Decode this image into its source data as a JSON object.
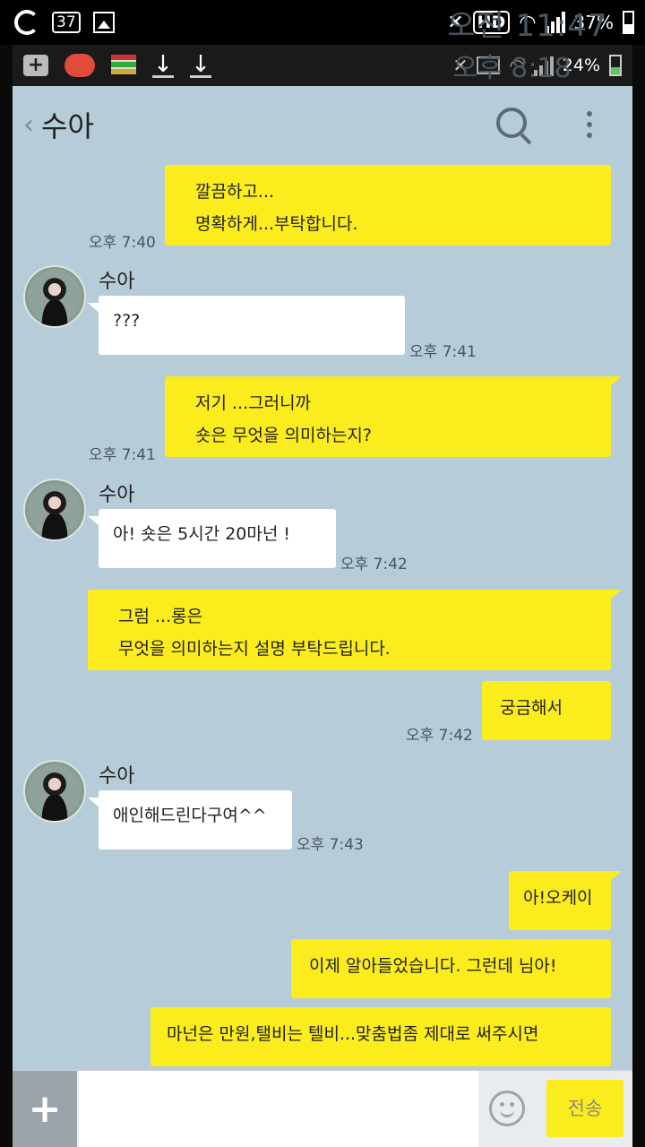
{
  "status_outer": {
    "badge": "37",
    "hd": "HD",
    "battery": "37%",
    "time": "오전 11:47"
  },
  "status_inner": {
    "battery": "24%",
    "time": "오후 8:18"
  },
  "header": {
    "title": "수아"
  },
  "messages": [
    {
      "side": "me",
      "lines": [
        "깔끔하고...",
        "명확하게...부탁합니다."
      ],
      "time": "오후 7:40"
    },
    {
      "side": "you",
      "sender": "수아",
      "lines": [
        "???"
      ],
      "time": "오후 7:41"
    },
    {
      "side": "me",
      "lines": [
        "저기 ...그러니까",
        "숏은 무엇을 의미하는지?"
      ],
      "time": "오후 7:41"
    },
    {
      "side": "you",
      "sender": "수아",
      "lines": [
        "아! 숏은 5시간 20마넌 !"
      ],
      "time": "오후 7:42"
    },
    {
      "side": "me",
      "lines": [
        "그럼 ...롱은",
        "무엇을 의미하는지 설명 부탁드립니다."
      ],
      "time": ""
    },
    {
      "side": "me",
      "lines": [
        "궁금해서"
      ],
      "time": "오후 7:42"
    },
    {
      "side": "you",
      "sender": "수아",
      "lines": [
        "애인해드린다구여^^"
      ],
      "time": "오후 7:43"
    },
    {
      "side": "me",
      "lines": [
        "아!오케이"
      ],
      "time": ""
    },
    {
      "side": "me",
      "lines": [
        "이제 알아들었습니다. 그런데 님아!"
      ],
      "time": ""
    },
    {
      "side": "me",
      "lines": [
        "마넌은 만원,탤비는 텔비...맞춤법좀 제대로 써주시면"
      ],
      "time": ""
    }
  ],
  "input": {
    "placeholder": "",
    "send_label": "전송"
  },
  "colors": {
    "chat_bg": "#b6ccd8",
    "my_bubble": "#fbec1e",
    "their_bubble": "#ffffff"
  }
}
